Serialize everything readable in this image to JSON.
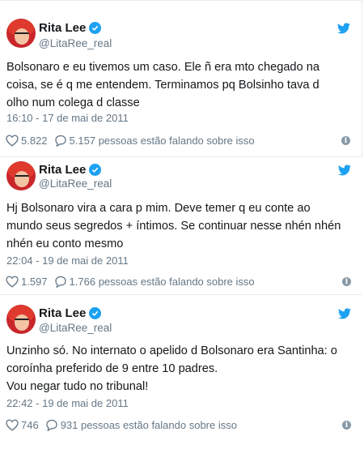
{
  "colors": {
    "verified": "#1da1f2",
    "twitter_bird": "#1da1f2",
    "meta_text": "#657786",
    "body_text": "#14171a"
  },
  "tweets": [
    {
      "author": {
        "name": "Rita Lee",
        "handle": "@LitaRee_real",
        "verified": true
      },
      "lines": [
        "Bolsonaro e eu tivemos um caso. Ele ñ era mto chegado na",
        "coisa, se é q me entendem. Terminamos pq Bolsinho tava d",
        "olho num colega d classe"
      ],
      "timestamp": "16:10 - 17 de mai de 2011",
      "likes": "5.822",
      "replies_text": "5.157 pessoas estão falando sobre isso",
      "icons": {
        "like": "heart-icon",
        "reply": "speech-bubble-icon",
        "info": "info-icon",
        "brand": "twitter-bird-icon"
      }
    },
    {
      "author": {
        "name": "Rita Lee",
        "handle": "@LitaRee_real",
        "verified": true
      },
      "lines": [
        "Hj Bolsonaro vira a cara p mim. Deve temer q eu conte ao",
        "mundo seus segredos + íntimos. Se continuar nesse nhén nhén",
        "nhén eu conto mesmo"
      ],
      "timestamp": "22:04 - 19 de mai de 2011",
      "likes": "1.597",
      "replies_text": "1.766 pessoas estão falando sobre isso",
      "icons": {
        "like": "heart-icon",
        "reply": "speech-bubble-icon",
        "info": "info-icon",
        "brand": "twitter-bird-icon"
      }
    },
    {
      "author": {
        "name": "Rita Lee",
        "handle": "@LitaRee_real",
        "verified": true
      },
      "lines": [
        "Unzinho só. No internato o apelido d Bolsonaro era Santinha: o",
        "coroínha preferido de 9 entre 10 padres.",
        "Vou negar tudo no tribunal!"
      ],
      "timestamp": "22:42 - 19 de mai de 2011",
      "likes": "746",
      "replies_text": "931 pessoas estão falando sobre isso",
      "icons": {
        "like": "heart-icon",
        "reply": "speech-bubble-icon",
        "info": "info-icon",
        "brand": "twitter-bird-icon"
      }
    }
  ]
}
